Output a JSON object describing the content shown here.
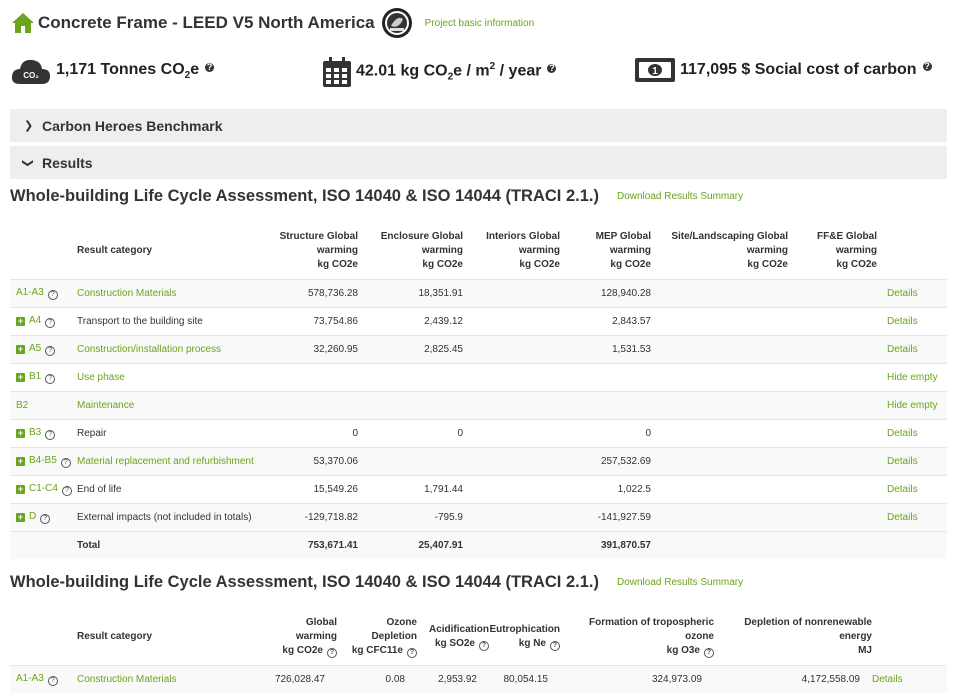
{
  "header": {
    "title": "Concrete Frame - LEED V5 North America",
    "basic_info_link": "Project basic information"
  },
  "kpis": {
    "co2_label": "1,171 Tonnes CO",
    "co2_sub": "2",
    "co2_suffix": "e",
    "intensity_label": "42.01 kg CO",
    "intensity_sub": "2",
    "intensity_mid": "e / m",
    "intensity_sup": "2",
    "intensity_suffix": " / year",
    "social_label": "117,095 $ Social cost of carbon"
  },
  "accordions": {
    "benchmark": "Carbon Heroes Benchmark",
    "results": "Results"
  },
  "section1": {
    "title": "Whole-building Life Cycle Assessment, ISO 14040 & ISO 14044 (TRACI 2.1.)",
    "download": "Download Results Summary",
    "headers": {
      "category": "Result category",
      "structure": [
        "Structure Global",
        "warming",
        "kg CO2e"
      ],
      "enclosure": [
        "Enclosure Global",
        "warming",
        "kg CO2e"
      ],
      "interiors": [
        "Interiors Global",
        "warming",
        "kg CO2e"
      ],
      "mep": [
        "MEP Global",
        "warming",
        "kg CO2e"
      ],
      "site": [
        "Site/Landscaping Global",
        "warming",
        "kg CO2e"
      ],
      "ffe": [
        "FF&E Global",
        "warming",
        "kg CO2e"
      ]
    },
    "rows": [
      {
        "code": "A1-A3",
        "cat": "Construction Materials",
        "structure": "578,736.28",
        "enclosure": "18,351.91",
        "interiors": "",
        "mep": "128,940.28",
        "site": "",
        "ffe": "",
        "action": "Details"
      },
      {
        "code": "A4",
        "cat": "Transport to the building site",
        "structure": "73,754.86",
        "enclosure": "2,439.12",
        "interiors": "",
        "mep": "2,843.57",
        "site": "",
        "ffe": "",
        "action": "Details"
      },
      {
        "code": "A5",
        "cat": "Construction/installation process",
        "structure": "32,260.95",
        "enclosure": "2,825.45",
        "interiors": "",
        "mep": "1,531.53",
        "site": "",
        "ffe": "",
        "action": "Details"
      },
      {
        "code": "B1",
        "cat": "Use phase",
        "structure": "",
        "enclosure": "",
        "interiors": "",
        "mep": "",
        "site": "",
        "ffe": "",
        "action": "Hide empty"
      },
      {
        "code": "B2",
        "cat": "Maintenance",
        "structure": "",
        "enclosure": "",
        "interiors": "",
        "mep": "",
        "site": "",
        "ffe": "",
        "action": "Hide empty"
      },
      {
        "code": "B3",
        "cat": "Repair",
        "structure": "0",
        "enclosure": "0",
        "interiors": "",
        "mep": "0",
        "site": "",
        "ffe": "",
        "action": "Details"
      },
      {
        "code": "B4-B5",
        "cat": "Material replacement and refurbishment",
        "structure": "53,370.06",
        "enclosure": "",
        "interiors": "",
        "mep": "257,532.69",
        "site": "",
        "ffe": "",
        "action": "Details"
      },
      {
        "code": "C1-C4",
        "cat": "End of life",
        "structure": "15,549.26",
        "enclosure": "1,791.44",
        "interiors": "",
        "mep": "1,022.5",
        "site": "",
        "ffe": "",
        "action": "Details"
      },
      {
        "code": "D",
        "cat": "External impacts (not included in totals)",
        "structure": "-129,718.82",
        "enclosure": "-795.9",
        "interiors": "",
        "mep": "-141,927.59",
        "site": "",
        "ffe": "",
        "action": "Details"
      }
    ],
    "total": {
      "label": "Total",
      "structure": "753,671.41",
      "enclosure": "25,407.91",
      "mep": "391,870.57"
    }
  },
  "section2": {
    "title": "Whole-building Life Cycle Assessment, ISO 14040 & ISO 14044 (TRACI 2.1.)",
    "download": "Download Results Summary",
    "headers": {
      "category": "Result category",
      "gw": [
        "Global",
        "warming",
        "kg CO2e"
      ],
      "ozone": [
        "Ozone",
        "Depletion",
        "kg CFC11e"
      ],
      "acid": [
        "Acidification",
        "kg SO2e"
      ],
      "eutro": [
        "Eutrophication",
        "kg Ne"
      ],
      "smog": [
        "Formation of tropospheric",
        "ozone",
        "kg O3e"
      ],
      "energy": [
        "Depletion of nonrenewable",
        "energy",
        "MJ"
      ]
    },
    "rows": [
      {
        "code": "A1-A3",
        "cat": "Construction Materials",
        "gw": "726,028.47",
        "ozone": "0.08",
        "acid": "2,953.92",
        "eutro": "80,054.15",
        "smog": "324,973.09",
        "energy": "4,172,558.09",
        "action": "Details"
      }
    ]
  },
  "colors": {
    "accent": "#6aa51b",
    "panel": "#eeeeee"
  }
}
